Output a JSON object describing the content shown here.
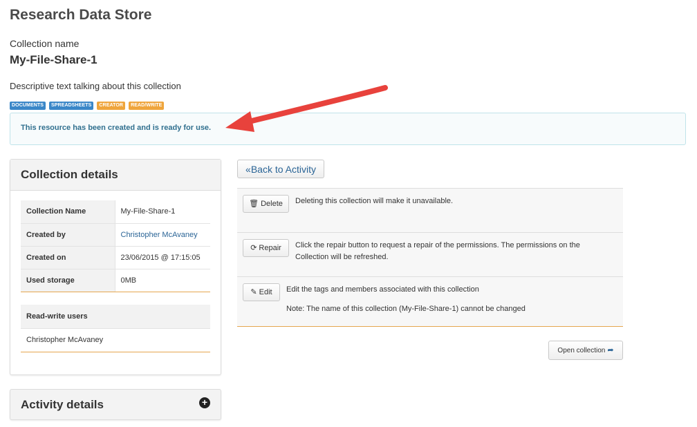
{
  "page": {
    "title": "Research Data Store"
  },
  "collection": {
    "label": "Collection name",
    "name": "My-File-Share-1",
    "description": "Descriptive text talking about this collection",
    "tags": [
      {
        "label": "DOCUMENTS",
        "color": "#3a87c8"
      },
      {
        "label": "SPREADSHEETS",
        "color": "#3a87c8"
      },
      {
        "label": "CREATOR",
        "color": "#efa53c"
      },
      {
        "label": "READ/WRITE",
        "color": "#efa53c"
      }
    ]
  },
  "alert": {
    "message": "This resource has been created and is ready for use."
  },
  "details_panel": {
    "title": "Collection details",
    "rows": [
      {
        "key": "Collection Name",
        "value": "My-File-Share-1"
      },
      {
        "key": "Created by",
        "value": "Christopher McAvaney"
      },
      {
        "key": "Created on",
        "value": "23/06/2015 @ 17:15:05"
      },
      {
        "key": "Used storage",
        "value": "0MB"
      }
    ],
    "users_header": "Read-write users",
    "users": [
      "Christopher McAvaney"
    ]
  },
  "activity_panel": {
    "title": "Activity details",
    "toggle_icon": "plus-circle-icon"
  },
  "back_button": {
    "label": "«Back to Activity"
  },
  "actions": [
    {
      "button": "Delete",
      "icon": "trash-icon",
      "text": "Deleting this collection will make it unavailable."
    },
    {
      "button": "Repair",
      "icon": "refresh-icon",
      "text": "Click the repair button to request a repair of the permissions. The permissions on the Collection will be refreshed."
    },
    {
      "button": "Edit",
      "icon": "edit-icon",
      "text": "Edit the tags and members associated with this collection",
      "note": "Note: The name of this collection (My-File-Share-1) cannot be changed"
    }
  ],
  "open_button": {
    "label": "Open collection",
    "icon": "share-arrow-icon"
  },
  "colors": {
    "accent_link": "#2a6496",
    "alert_text": "#31708f",
    "divider_orange": "#e5a64e",
    "annotation_arrow": "#e8423c"
  }
}
